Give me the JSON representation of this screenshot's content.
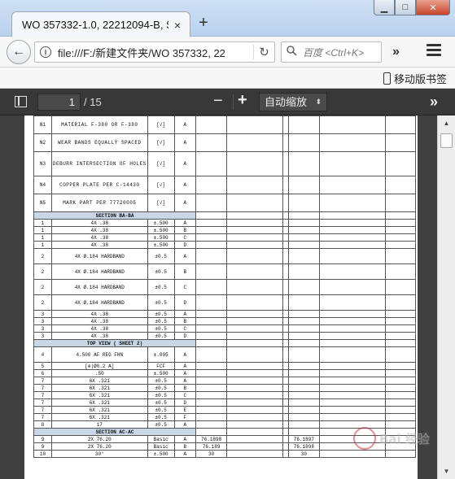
{
  "browser": {
    "tab_title": "WO 357332-1.0, 22212094-B, S",
    "tab_close": "×",
    "new_tab": "+",
    "window_buttons": {
      "minimize": "▁",
      "maximize": "□",
      "close": "✕"
    },
    "back_glyph": "←",
    "url": "file:///F:/新建文件夹/WO 357332, 22",
    "reload_glyph": "↻",
    "search_placeholder": "百度 <Ctrl+K>",
    "overflow_glyph": "»",
    "bookmark_item": "移动版书签"
  },
  "pdf_toolbar": {
    "page_current": "1",
    "page_total": "/ 15",
    "zoom_out": "−",
    "zoom_in": "+",
    "zoom_value": "自动缩放",
    "zoom_arrow": "⬍",
    "tools_glyph": "»"
  },
  "table": {
    "rows": [
      {
        "c1": "N1",
        "c2": "MATERIAL  F-380 OR F-380",
        "c3": "[√]",
        "c4": "A"
      },
      {
        "c1": "N2",
        "c2": "WEAR BANDS EQUALLY SPACED",
        "c3": "[√]",
        "c4": "A"
      },
      {
        "c1": "N3",
        "c2": "DEBURR INTERSECTION OF HOLES",
        "c3": "[√]",
        "c4": "A"
      },
      {
        "c1": "N4",
        "c2": "COPPER PLATE PER C-14430",
        "c3": "[√]",
        "c4": "A"
      },
      {
        "c1": "N5",
        "c2": "MARK PART PER 77720005",
        "c3": "[√]",
        "c4": "A"
      },
      {
        "section": "SECTION BA-BA"
      },
      {
        "c1": "1",
        "c2": "4X .38",
        "c3": "±.500",
        "c4": "A"
      },
      {
        "c1": "1",
        "c2": "4X .38",
        "c3": "±.500",
        "c4": "B"
      },
      {
        "c1": "1",
        "c2": "4X .38",
        "c3": "±.500",
        "c4": "C"
      },
      {
        "c1": "1",
        "c2": "4X .38",
        "c3": "±.500",
        "c4": "D"
      },
      {
        "c1": "2",
        "c2": "4X Ø.184 HARDBAND",
        "c3": "±0.5",
        "c4": "A",
        "tall": true
      },
      {
        "c1": "2",
        "c2": "4X Ø.184 HARDBAND",
        "c3": "±0.5",
        "c4": "B",
        "tall": true
      },
      {
        "c1": "2",
        "c2": "4X Ø.184 HARDBAND",
        "c3": "±0.5",
        "c4": "C",
        "tall": true
      },
      {
        "c1": "2",
        "c2": "4X Ø.184 HARDBAND",
        "c3": "±0.5",
        "c4": "D",
        "tall": true
      },
      {
        "c1": "3",
        "c2": "4X .38",
        "c3": "±0.5",
        "c4": "A"
      },
      {
        "c1": "3",
        "c2": "4X .38",
        "c3": "±0.5",
        "c4": "B"
      },
      {
        "c1": "3",
        "c2": "4X .38",
        "c3": "±0.5",
        "c4": "C"
      },
      {
        "c1": "3",
        "c2": "4X .38",
        "c3": "±0.5",
        "c4": "D"
      },
      {
        "section": "TOP VIEW ( SHEET 2)"
      },
      {
        "c1": "4",
        "c2": "4.500 AF REG FHN",
        "c3": "±.005",
        "c4": "A",
        "tall": true
      },
      {
        "c1": "5",
        "c2": "[⊕|Ø0.2 A]",
        "c3": "FCF",
        "c4": "A"
      },
      {
        "c1": "6",
        "c2": ".50",
        "c3": "±.500",
        "c4": "A"
      },
      {
        "c1": "7",
        "c2": "6X .321",
        "c3": "±0.5",
        "c4": "A"
      },
      {
        "c1": "7",
        "c2": "6X .321",
        "c3": "±0.5",
        "c4": "B"
      },
      {
        "c1": "7",
        "c2": "6X .321",
        "c3": "±0.5",
        "c4": "C"
      },
      {
        "c1": "7",
        "c2": "6X .321",
        "c3": "±0.5",
        "c4": "D"
      },
      {
        "c1": "7",
        "c2": "6X .321",
        "c3": "±0.5",
        "c4": "E"
      },
      {
        "c1": "7",
        "c2": "6X .321",
        "c3": "±0.5",
        "c4": "F"
      },
      {
        "c1": "8",
        "c2": "17",
        "c3": "±0.5",
        "c4": "A"
      },
      {
        "section": "SECTION AC-AC"
      },
      {
        "c1": "9",
        "c2": "2X 76.20",
        "c3": "Basic",
        "c4": "A",
        "c5": "76.1898",
        "c8": "76.1897"
      },
      {
        "c1": "9",
        "c2": "2X 76.20",
        "c3": "Basic",
        "c4": "B",
        "c5": "76.189",
        "c8": "76.1898"
      },
      {
        "c1": "10",
        "c2": "30°",
        "c3": "±.500",
        "c4": "A",
        "c5": "30",
        "c8": "30"
      }
    ]
  },
  "watermark": "Bai 经验"
}
